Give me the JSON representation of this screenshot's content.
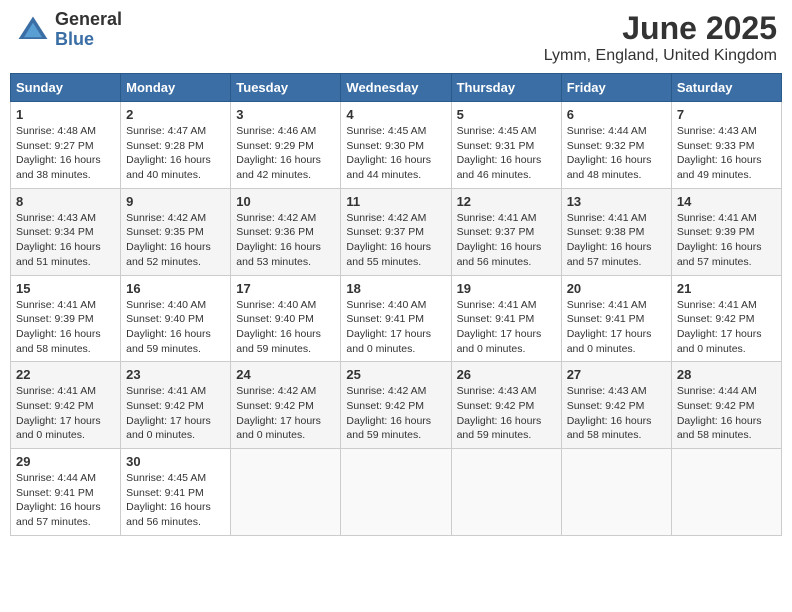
{
  "logo": {
    "general": "General",
    "blue": "Blue"
  },
  "title": "June 2025",
  "subtitle": "Lymm, England, United Kingdom",
  "days_header": [
    "Sunday",
    "Monday",
    "Tuesday",
    "Wednesday",
    "Thursday",
    "Friday",
    "Saturday"
  ],
  "weeks": [
    [
      {
        "day": "1",
        "sunrise": "Sunrise: 4:48 AM",
        "sunset": "Sunset: 9:27 PM",
        "daylight": "Daylight: 16 hours and 38 minutes."
      },
      {
        "day": "2",
        "sunrise": "Sunrise: 4:47 AM",
        "sunset": "Sunset: 9:28 PM",
        "daylight": "Daylight: 16 hours and 40 minutes."
      },
      {
        "day": "3",
        "sunrise": "Sunrise: 4:46 AM",
        "sunset": "Sunset: 9:29 PM",
        "daylight": "Daylight: 16 hours and 42 minutes."
      },
      {
        "day": "4",
        "sunrise": "Sunrise: 4:45 AM",
        "sunset": "Sunset: 9:30 PM",
        "daylight": "Daylight: 16 hours and 44 minutes."
      },
      {
        "day": "5",
        "sunrise": "Sunrise: 4:45 AM",
        "sunset": "Sunset: 9:31 PM",
        "daylight": "Daylight: 16 hours and 46 minutes."
      },
      {
        "day": "6",
        "sunrise": "Sunrise: 4:44 AM",
        "sunset": "Sunset: 9:32 PM",
        "daylight": "Daylight: 16 hours and 48 minutes."
      },
      {
        "day": "7",
        "sunrise": "Sunrise: 4:43 AM",
        "sunset": "Sunset: 9:33 PM",
        "daylight": "Daylight: 16 hours and 49 minutes."
      }
    ],
    [
      {
        "day": "8",
        "sunrise": "Sunrise: 4:43 AM",
        "sunset": "Sunset: 9:34 PM",
        "daylight": "Daylight: 16 hours and 51 minutes."
      },
      {
        "day": "9",
        "sunrise": "Sunrise: 4:42 AM",
        "sunset": "Sunset: 9:35 PM",
        "daylight": "Daylight: 16 hours and 52 minutes."
      },
      {
        "day": "10",
        "sunrise": "Sunrise: 4:42 AM",
        "sunset": "Sunset: 9:36 PM",
        "daylight": "Daylight: 16 hours and 53 minutes."
      },
      {
        "day": "11",
        "sunrise": "Sunrise: 4:42 AM",
        "sunset": "Sunset: 9:37 PM",
        "daylight": "Daylight: 16 hours and 55 minutes."
      },
      {
        "day": "12",
        "sunrise": "Sunrise: 4:41 AM",
        "sunset": "Sunset: 9:37 PM",
        "daylight": "Daylight: 16 hours and 56 minutes."
      },
      {
        "day": "13",
        "sunrise": "Sunrise: 4:41 AM",
        "sunset": "Sunset: 9:38 PM",
        "daylight": "Daylight: 16 hours and 57 minutes."
      },
      {
        "day": "14",
        "sunrise": "Sunrise: 4:41 AM",
        "sunset": "Sunset: 9:39 PM",
        "daylight": "Daylight: 16 hours and 57 minutes."
      }
    ],
    [
      {
        "day": "15",
        "sunrise": "Sunrise: 4:41 AM",
        "sunset": "Sunset: 9:39 PM",
        "daylight": "Daylight: 16 hours and 58 minutes."
      },
      {
        "day": "16",
        "sunrise": "Sunrise: 4:40 AM",
        "sunset": "Sunset: 9:40 PM",
        "daylight": "Daylight: 16 hours and 59 minutes."
      },
      {
        "day": "17",
        "sunrise": "Sunrise: 4:40 AM",
        "sunset": "Sunset: 9:40 PM",
        "daylight": "Daylight: 16 hours and 59 minutes."
      },
      {
        "day": "18",
        "sunrise": "Sunrise: 4:40 AM",
        "sunset": "Sunset: 9:41 PM",
        "daylight": "Daylight: 17 hours and 0 minutes."
      },
      {
        "day": "19",
        "sunrise": "Sunrise: 4:41 AM",
        "sunset": "Sunset: 9:41 PM",
        "daylight": "Daylight: 17 hours and 0 minutes."
      },
      {
        "day": "20",
        "sunrise": "Sunrise: 4:41 AM",
        "sunset": "Sunset: 9:41 PM",
        "daylight": "Daylight: 17 hours and 0 minutes."
      },
      {
        "day": "21",
        "sunrise": "Sunrise: 4:41 AM",
        "sunset": "Sunset: 9:42 PM",
        "daylight": "Daylight: 17 hours and 0 minutes."
      }
    ],
    [
      {
        "day": "22",
        "sunrise": "Sunrise: 4:41 AM",
        "sunset": "Sunset: 9:42 PM",
        "daylight": "Daylight: 17 hours and 0 minutes."
      },
      {
        "day": "23",
        "sunrise": "Sunrise: 4:41 AM",
        "sunset": "Sunset: 9:42 PM",
        "daylight": "Daylight: 17 hours and 0 minutes."
      },
      {
        "day": "24",
        "sunrise": "Sunrise: 4:42 AM",
        "sunset": "Sunset: 9:42 PM",
        "daylight": "Daylight: 17 hours and 0 minutes."
      },
      {
        "day": "25",
        "sunrise": "Sunrise: 4:42 AM",
        "sunset": "Sunset: 9:42 PM",
        "daylight": "Daylight: 16 hours and 59 minutes."
      },
      {
        "day": "26",
        "sunrise": "Sunrise: 4:43 AM",
        "sunset": "Sunset: 9:42 PM",
        "daylight": "Daylight: 16 hours and 59 minutes."
      },
      {
        "day": "27",
        "sunrise": "Sunrise: 4:43 AM",
        "sunset": "Sunset: 9:42 PM",
        "daylight": "Daylight: 16 hours and 58 minutes."
      },
      {
        "day": "28",
        "sunrise": "Sunrise: 4:44 AM",
        "sunset": "Sunset: 9:42 PM",
        "daylight": "Daylight: 16 hours and 58 minutes."
      }
    ],
    [
      {
        "day": "29",
        "sunrise": "Sunrise: 4:44 AM",
        "sunset": "Sunset: 9:41 PM",
        "daylight": "Daylight: 16 hours and 57 minutes."
      },
      {
        "day": "30",
        "sunrise": "Sunrise: 4:45 AM",
        "sunset": "Sunset: 9:41 PM",
        "daylight": "Daylight: 16 hours and 56 minutes."
      },
      null,
      null,
      null,
      null,
      null
    ]
  ]
}
